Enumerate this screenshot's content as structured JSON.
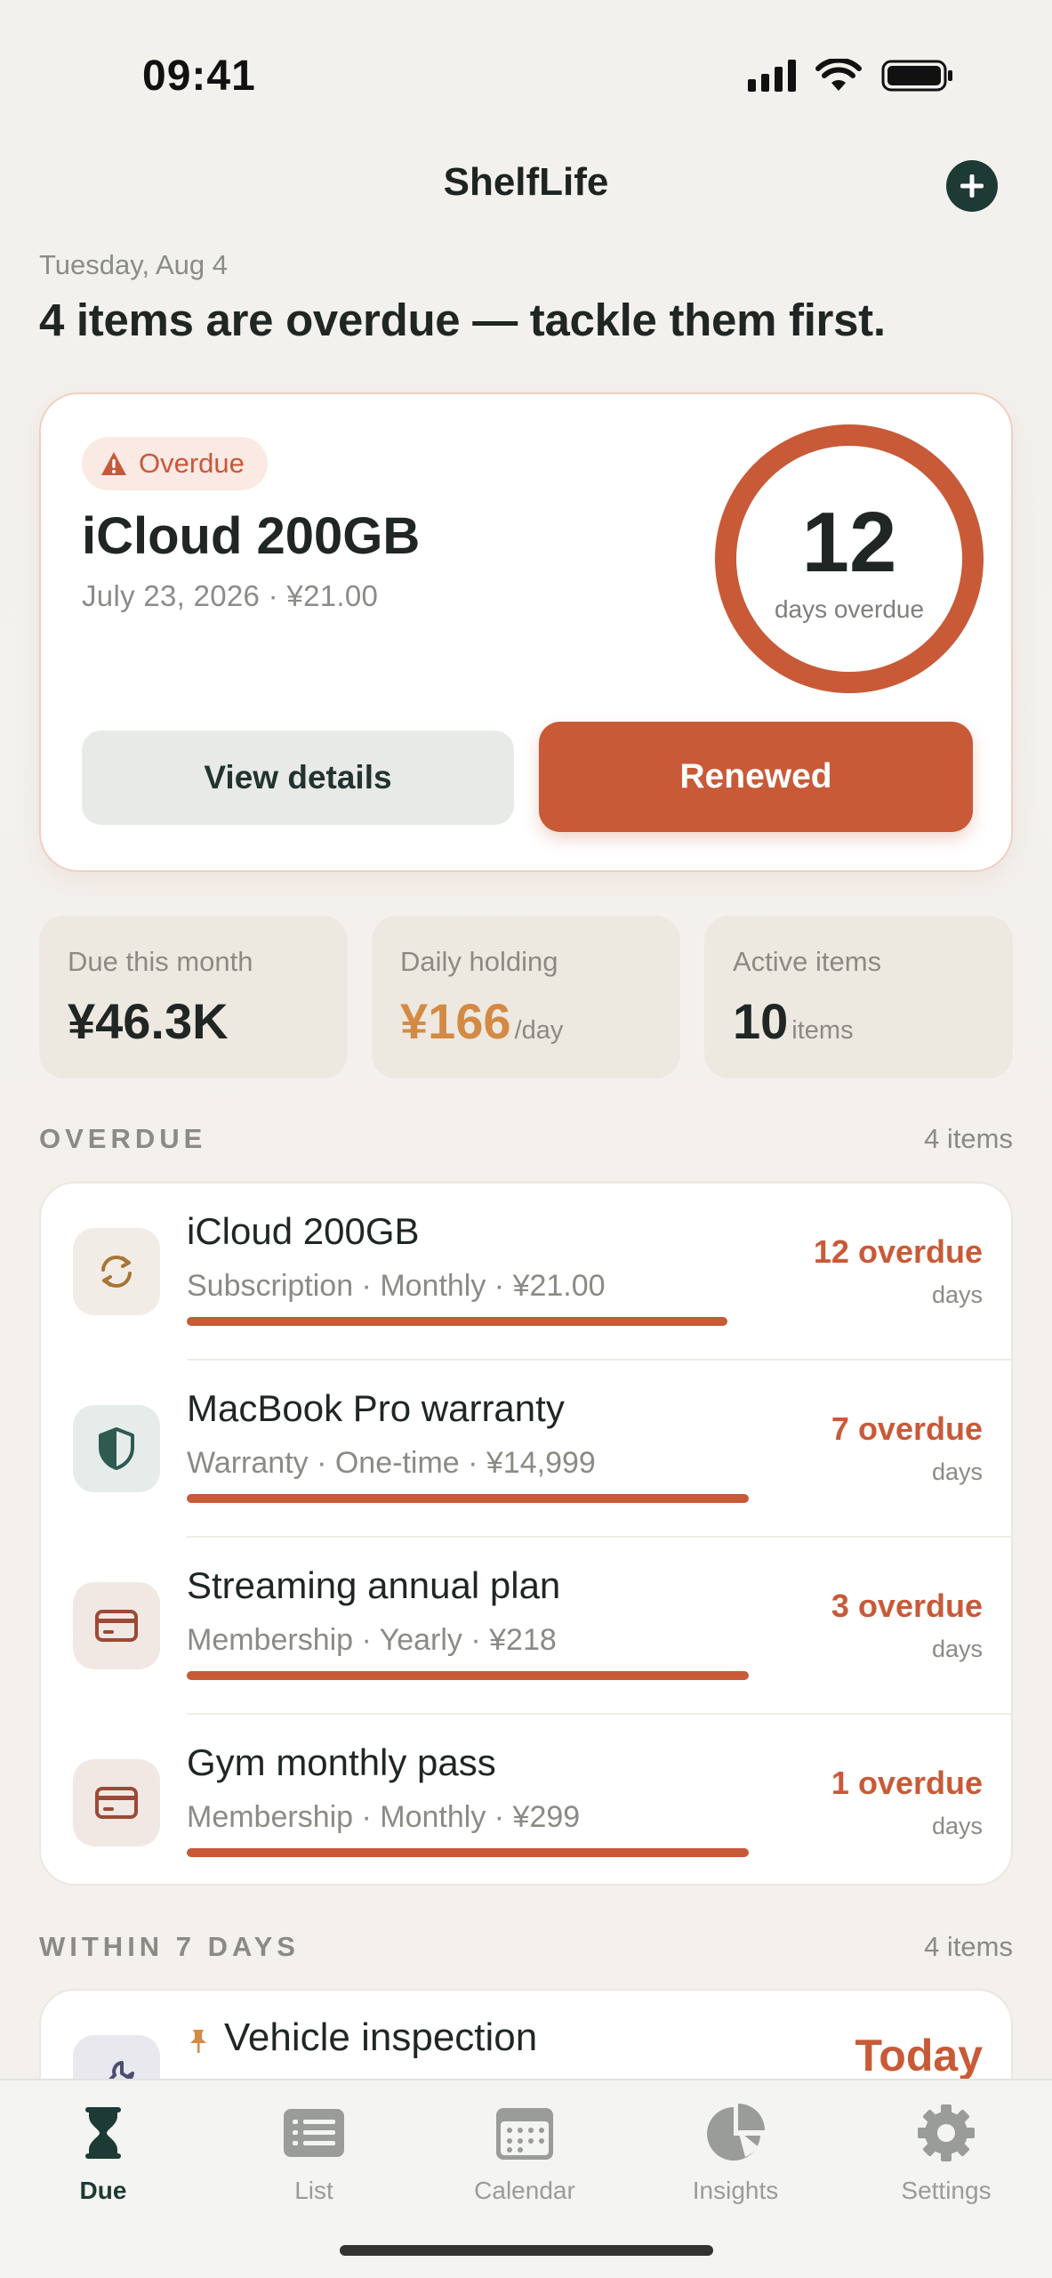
{
  "status_bar": {
    "time": "09:41"
  },
  "nav": {
    "title": "ShelfLife",
    "add_icon": "plus-icon"
  },
  "date": "Tuesday, Aug 4",
  "headline": "4 items are overdue — tackle them first.",
  "colors": {
    "accent": "#C85A38",
    "brand_dark": "#1E3A35",
    "amber": "#D38A45",
    "background": "#F4F1EC"
  },
  "hero": {
    "badge": "Overdue",
    "title": "iCloud 200GB",
    "subtitle": "July 23, 2026 · ¥21.00",
    "ring_value": "12",
    "ring_caption": "days overdue",
    "view_details_label": "View details",
    "renewed_label": "Renewed"
  },
  "stats": [
    {
      "label": "Due this month",
      "value": "¥46.3K",
      "unit": ""
    },
    {
      "label": "Daily holding",
      "value": "¥166",
      "unit": "/day"
    },
    {
      "label": "Active items",
      "value": "10",
      "unit": "items"
    }
  ],
  "overdue_section": {
    "title": "OVERDUE",
    "count": "4 items",
    "items": [
      {
        "icon": "renew-icon",
        "title": "iCloud 200GB",
        "meta": "Subscription · Monthly · ¥21.00",
        "status": "12 overdue",
        "unit": "days",
        "progress": 0.92
      },
      {
        "icon": "shield-icon",
        "title": "MacBook Pro warranty",
        "meta": "Warranty · One-time · ¥14,999",
        "status": "7 overdue",
        "unit": "days",
        "progress": 0.96
      },
      {
        "icon": "card-icon",
        "title": "Streaming annual plan",
        "meta": "Membership · Yearly · ¥218",
        "status": "3 overdue",
        "unit": "days",
        "progress": 0.96
      },
      {
        "icon": "card-icon",
        "title": "Gym monthly pass",
        "meta": "Membership · Monthly · ¥299",
        "status": "1 overdue",
        "unit": "days",
        "progress": 0.96
      }
    ]
  },
  "within_section": {
    "title": "WITHIN 7 DAYS",
    "count": "4 items",
    "items": [
      {
        "icon": "wrench-icon",
        "pin_icon": "pin-icon",
        "title": "Vehicle inspection",
        "status": "Today"
      }
    ]
  },
  "tabs": [
    {
      "label": "Due",
      "icon": "hourglass-icon",
      "active": true
    },
    {
      "label": "List",
      "icon": "list-icon",
      "active": false
    },
    {
      "label": "Calendar",
      "icon": "calendar-icon",
      "active": false
    },
    {
      "label": "Insights",
      "icon": "pie-chart-icon",
      "active": false
    },
    {
      "label": "Settings",
      "icon": "gear-icon",
      "active": false
    }
  ]
}
